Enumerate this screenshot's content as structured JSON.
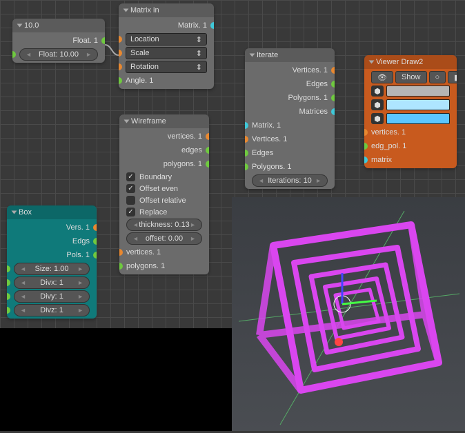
{
  "float_node": {
    "title": "10.0",
    "out": "Float. 1",
    "field": "Float:",
    "value": "10.00"
  },
  "matrix_node": {
    "title": "Matrix in",
    "out": "Matrix. 1",
    "sel1": "Location",
    "sel2": "Scale",
    "sel3": "Rotation",
    "in": "Angle. 1"
  },
  "box_node": {
    "title": "Box",
    "out1": "Vers. 1",
    "out2": "Edgs",
    "out3": "Pols. 1",
    "f1": {
      "l": "Size:",
      "v": "1.00"
    },
    "f2": {
      "l": "Divx:",
      "v": "1"
    },
    "f3": {
      "l": "Divy:",
      "v": "1"
    },
    "f4": {
      "l": "Divz:",
      "v": "1"
    }
  },
  "wire_node": {
    "title": "Wireframe",
    "out1": "vertices. 1",
    "out2": "edges",
    "out3": "polygons. 1",
    "chk1": "Boundary",
    "chk2": "Offset even",
    "chk3": "Offset relative",
    "chk4": "Replace",
    "f1": {
      "l": "thickness:",
      "v": "0.13"
    },
    "f2": {
      "l": "offset:",
      "v": "0.00"
    },
    "in1": "vertices. 1",
    "in2": "polygons. 1"
  },
  "iter_node": {
    "title": "Iterate",
    "out1": "Vertices. 1",
    "out2": "Edges",
    "out3": "Polygons. 1",
    "out4": "Matrices",
    "in1": "Matrix. 1",
    "in2": "Vertices. 1",
    "in3": "Edges",
    "in4": "Polygons. 1",
    "f": {
      "l": "Iterations:",
      "v": "10"
    }
  },
  "viewer_node": {
    "title": "Viewer Draw2",
    "btn": "Show",
    "in1": "vertices. 1",
    "in2": "edg_pol. 1",
    "in3": "matrix",
    "colors": [
      "#b5b5b5",
      "#aee5ff",
      "#5cc6ff"
    ]
  }
}
